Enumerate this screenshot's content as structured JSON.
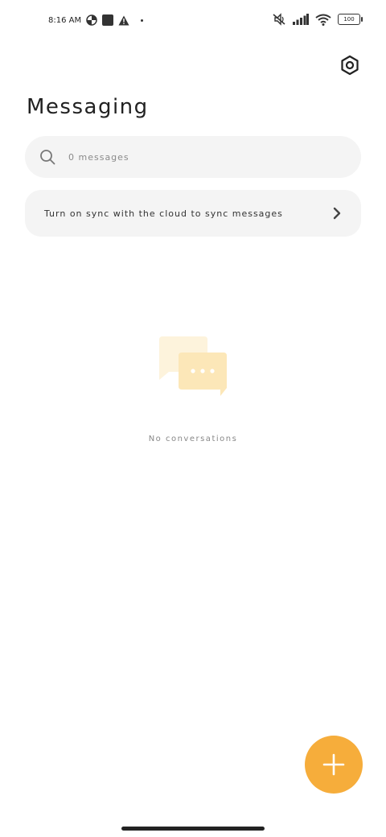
{
  "status_bar": {
    "time": "8:16 AM",
    "battery": "100",
    "icons": [
      "data-saver-icon",
      "square-icon",
      "warning-icon",
      "dot-icon",
      "mute-icon",
      "signal-icon",
      "wifi-icon",
      "battery-icon"
    ]
  },
  "header": {
    "title": "Messaging",
    "settings_icon": "settings-icon"
  },
  "search": {
    "placeholder": "0 messages",
    "value": ""
  },
  "sync_card": {
    "label": "Turn on sync with the cloud to sync messages"
  },
  "empty_state": {
    "text": "No conversations"
  },
  "fab": {
    "icon": "plus-icon"
  },
  "colors": {
    "accent": "#f6ad3b",
    "card_bg": "#f4f4f4",
    "illustration_back": "#fdf3dc",
    "illustration_front": "#fce7b8"
  }
}
